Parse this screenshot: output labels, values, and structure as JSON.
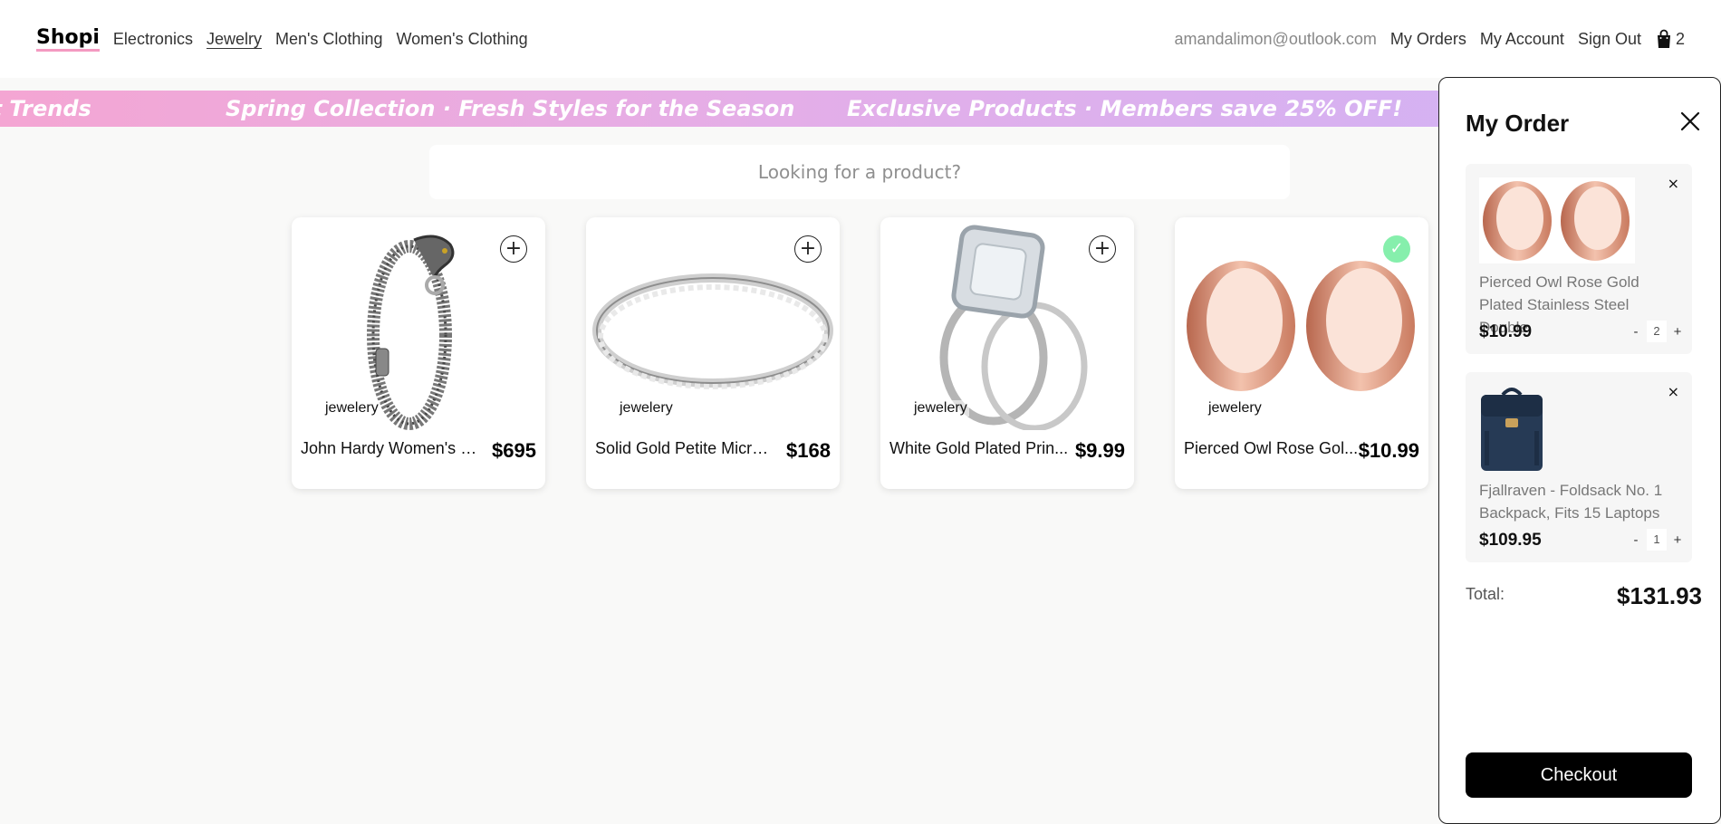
{
  "brand": {
    "logo": "Shopi"
  },
  "nav": {
    "categories": [
      "Electronics",
      "Jewelry",
      "Men's Clothing",
      "Women's Clothing"
    ],
    "active": "Jewelry",
    "email": "amandalimon@outlook.com",
    "my_orders": "My Orders",
    "my_account": "My Account",
    "sign_out": "Sign Out",
    "cart_count": "2",
    "cart_icon": "shopping-bag-icon"
  },
  "banner": {
    "items": [
      "est Trends",
      "Spring Collection · Fresh Styles for the Season",
      "Exclusive Products · Members save 25% OFF!"
    ]
  },
  "search": {
    "placeholder": "Looking for a product?",
    "value": ""
  },
  "products": [
    {
      "category": "jewelery",
      "name": "John Hardy Women's Le...",
      "price": "$695",
      "image": "dragon-bracelet",
      "added": false
    },
    {
      "category": "jewelery",
      "name": "Solid Gold Petite Microp...",
      "price": "$168",
      "image": "silver-band-ring",
      "added": false
    },
    {
      "category": "jewelery",
      "name": "White Gold Plated Prin...",
      "price": "$9.99",
      "image": "diamond-ring-set",
      "added": false
    },
    {
      "category": "jewelery",
      "name": "Pierced Owl Rose Gol...",
      "price": "$10.99",
      "image": "rose-gold-tunnels",
      "added": true
    }
  ],
  "order": {
    "title": "My Order",
    "items": [
      {
        "name": "Pierced Owl Rose Gold Plated Stainless Steel Double",
        "price": "$10.99",
        "qty": "2",
        "image": "rose-gold-tunnels"
      },
      {
        "name": "Fjallraven - Foldsack No. 1 Backpack, Fits 15 Laptops",
        "price": "$109.95",
        "qty": "1",
        "image": "navy-backpack"
      }
    ],
    "remove_label": "×",
    "minus_label": "-",
    "plus_label": "+",
    "total_label": "Total:",
    "total_value": "$131.93",
    "checkout_label": "Checkout"
  },
  "colors": {
    "accent_pink": "#f49ac1",
    "added_green": "#86efac",
    "banner_start": "#f4a6d3",
    "banner_end": "#cfb3f6"
  }
}
